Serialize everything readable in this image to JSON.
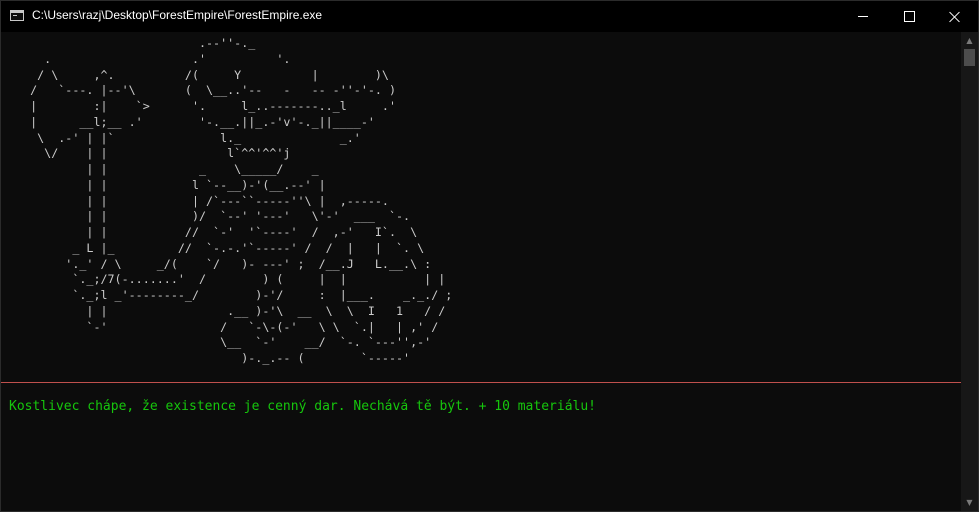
{
  "window": {
    "title": "C:\\Users\\razj\\Desktop\\ForestEmpire\\ForestEmpire.exe"
  },
  "controls": {
    "minimize_icon": "minimize-icon",
    "maximize_icon": "maximize-icon",
    "close_icon": "close-icon"
  },
  "console": {
    "ascii_art": "                           .--''-._\n     .                    .'          '.\n    / \\     ,^.          /(     Y          |        )\\\n   /   `---. |--'\\       (  \\__..'--   -   -- -''-'-. )\n   |        :|    `>      '.     l_..-------.._l     .'\n   |      __l;__ .'        '-.__.||_.-'v'-._||____-'\n    \\  .-' | |`               l._              _.'\n     \\/    | |                 l`^^'^^'j\n           | |             _    \\_____/    _\n           | |            l `--__)-'(__.--' |\n           | |            | /`---``-----''\\ |  ,-----.\n           | |            )/  `--' '---'   \\'-'  ___  `-.\n           | |           //  `-'  '`----'  /  ,-'   I`.  \\\n         _ L |_         //  `-.-.'`-----' /  /  |   |  `. \\\n        '._' / \\     _/(    `/   )- ---' ;  /__.J   L.__.\\ :\n         `._;/7(-.......'  /        ) (     |  |           | |\n         `._;l _'--------_/        )-'/     :  |___.    _._./ ;\n           | |                 .__ )-'\\  __  \\  \\  I   1   / /\n           `-'                /   `-\\-(-'   \\ \\  `.|   | ,' /\n                              \\__  `-'    __/  `-. `---'',-'\n                                 )-._.-- (        `-----'",
    "message": "Kostlivec chápe, že existence je cenný dar. Nechává tě být. + 10 materiálu!"
  },
  "colors": {
    "background": "#0c0c0c",
    "art_text": "#cccccc",
    "message_text": "#16c60c",
    "separator": "#c0504d"
  },
  "scrollbar": {
    "up_arrow": "▲",
    "down_arrow": "▼"
  }
}
